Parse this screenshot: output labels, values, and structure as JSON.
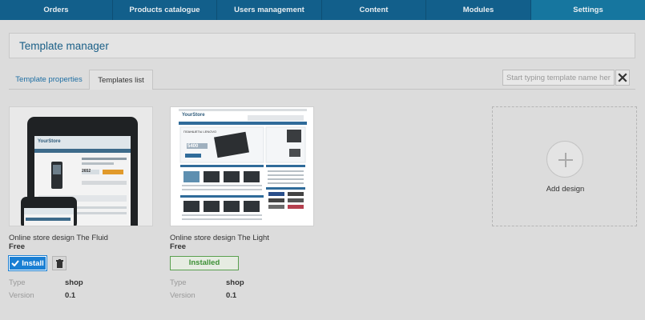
{
  "nav": {
    "items": [
      {
        "label": "Orders"
      },
      {
        "label": "Products catalogue"
      },
      {
        "label": "Users management"
      },
      {
        "label": "Content"
      },
      {
        "label": "Modules"
      },
      {
        "label": "Settings"
      }
    ]
  },
  "page": {
    "title": "Template manager"
  },
  "tabs": {
    "properties": "Template properties",
    "list": "Templates list"
  },
  "search": {
    "placeholder": "Start typing template name here..."
  },
  "templates": [
    {
      "name": "Online store design The Fluid",
      "price": "Free",
      "action": "Install",
      "type_label": "Type",
      "type": "shop",
      "version_label": "Version",
      "version": "0.1"
    },
    {
      "name": "Online store design The Light",
      "price": "Free",
      "action": "Installed",
      "type_label": "Type",
      "type": "shop",
      "version_label": "Version",
      "version": "0.1",
      "preview": {
        "logo": "YourStore",
        "banner_text": "ПЛАНШЕТЫ LENOVO",
        "banner_price": "5400"
      }
    }
  ],
  "fluid_preview": {
    "logo": "YourStore",
    "price": "2652"
  },
  "add_design": {
    "label": "Add design"
  },
  "colors": {
    "nav": "#125f8b",
    "nav_active": "#16769f",
    "accent": "#1a7fd3",
    "installed": "#3c8f34"
  }
}
